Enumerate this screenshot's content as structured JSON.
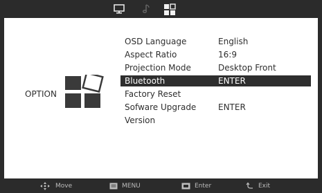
{
  "top_tabs": [
    {
      "name": "picture-tab",
      "icon": "monitor-icon",
      "active": false
    },
    {
      "name": "audio-tab",
      "icon": "music-note-icon",
      "active": false
    },
    {
      "name": "option-tab",
      "icon": "option-grid-icon",
      "active": true
    }
  ],
  "category": {
    "label": "OPTION",
    "icon": "option-grid-icon"
  },
  "menu": {
    "items": [
      {
        "label": "OSD Language",
        "value": "English"
      },
      {
        "label": "Aspect Ratio",
        "value": "16:9"
      },
      {
        "label": "Projection Mode",
        "value": "Desktop Front"
      },
      {
        "label": "Bluetooth",
        "value": "ENTER",
        "selected": true
      },
      {
        "label": "Factory Reset",
        "value": ""
      },
      {
        "label": "Sofware Upgrade",
        "value": "ENTER"
      },
      {
        "label": "Version",
        "value": ""
      }
    ]
  },
  "hints": [
    {
      "icon": "dpad-icon",
      "label": "Move"
    },
    {
      "icon": "menu-key-icon",
      "label": "MENU"
    },
    {
      "icon": "ok-key-icon",
      "label": "Enter"
    },
    {
      "icon": "return-icon",
      "label": "Exit"
    }
  ],
  "colors": {
    "background": "#ffffff",
    "frame": "#2b2b2b",
    "selection": "#2e2e2e",
    "text": "#2e2e2e",
    "hint_text": "#bdbdbd"
  }
}
